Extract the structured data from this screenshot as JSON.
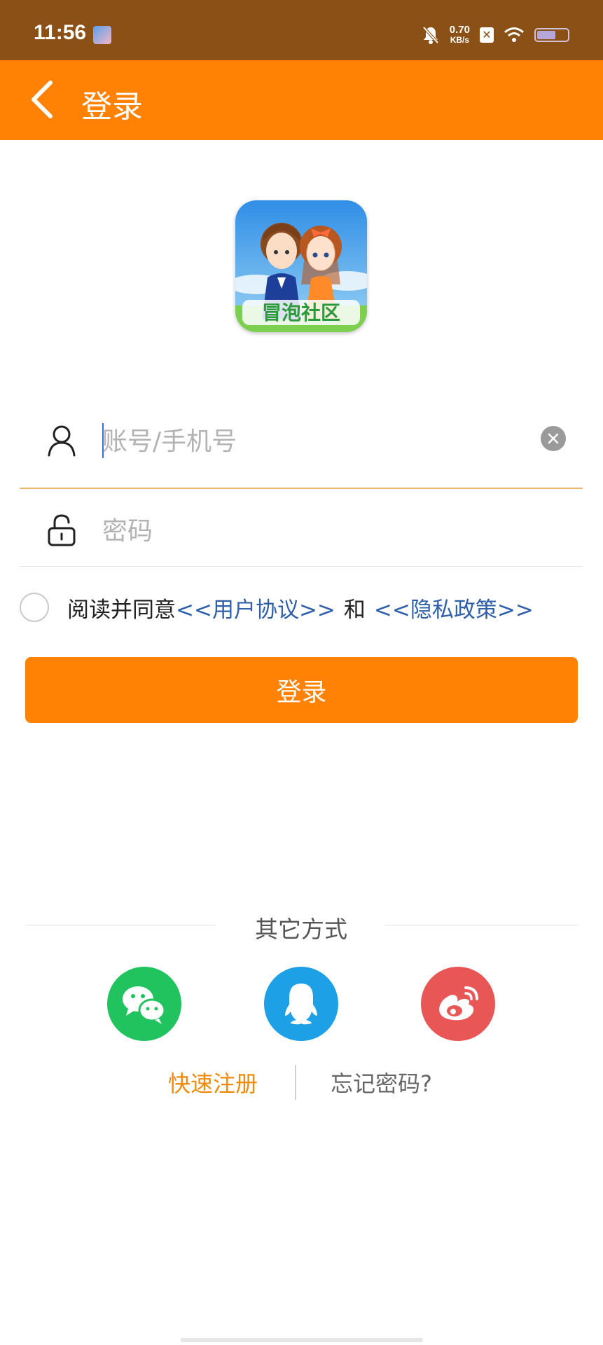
{
  "status_bar": {
    "time": "11:56",
    "net_speed_value": "0.70",
    "net_speed_unit": "KB/s",
    "icons": [
      "app-notification-icon",
      "mute-bell-icon",
      "x-app-icon",
      "wifi-icon",
      "battery-icon"
    ]
  },
  "header": {
    "title": "登录",
    "back_icon": "chevron-left-icon"
  },
  "form": {
    "account_placeholder": "账号/手机号",
    "account_value": "",
    "password_placeholder": "密码",
    "password_value": "",
    "agree_prefix": "阅读并同意",
    "user_agreement": "<<用户协议>>",
    "and_text": "和",
    "privacy_policy": "<<隐私政策>>",
    "agree_checked": false,
    "login_button": "登录"
  },
  "other_methods": {
    "title": "其它方式",
    "options": [
      {
        "name": "wechat",
        "icon": "wechat-icon",
        "color": "#21c35e"
      },
      {
        "name": "qq",
        "icon": "qq-icon",
        "color": "#1ea0e6"
      },
      {
        "name": "weibo",
        "icon": "weibo-icon",
        "color": "#e85656"
      }
    ]
  },
  "footer_links": {
    "register": "快速注册",
    "forgot_password": "忘记密码?"
  },
  "colors": {
    "status_bar": "#8a5016",
    "accent": "#ff8205",
    "link": "#2e5fa8",
    "register_link": "#ef8a0b"
  }
}
